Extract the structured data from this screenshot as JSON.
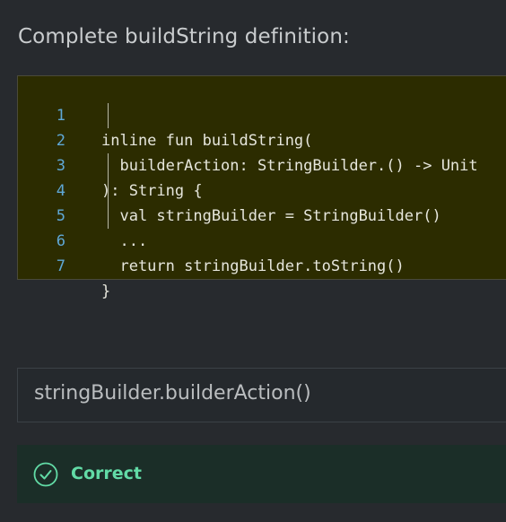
{
  "prompt": "Complete buildString definition:",
  "code": {
    "lines": [
      {
        "num": "1",
        "text": "inline fun buildString("
      },
      {
        "num": "2",
        "text": "  builderAction: StringBuilder.() -> Unit"
      },
      {
        "num": "3",
        "text": "): String {"
      },
      {
        "num": "4",
        "text": "  val stringBuilder = StringBuilder()"
      },
      {
        "num": "5",
        "text": "  ..."
      },
      {
        "num": "6",
        "text": "  return stringBuilder.toString()"
      },
      {
        "num": "7",
        "text": "}"
      }
    ]
  },
  "answer": {
    "value": "stringBuilder.builderAction()"
  },
  "result": {
    "label": "Correct",
    "icon": "check-circle-icon",
    "color": "#62dba6"
  }
}
